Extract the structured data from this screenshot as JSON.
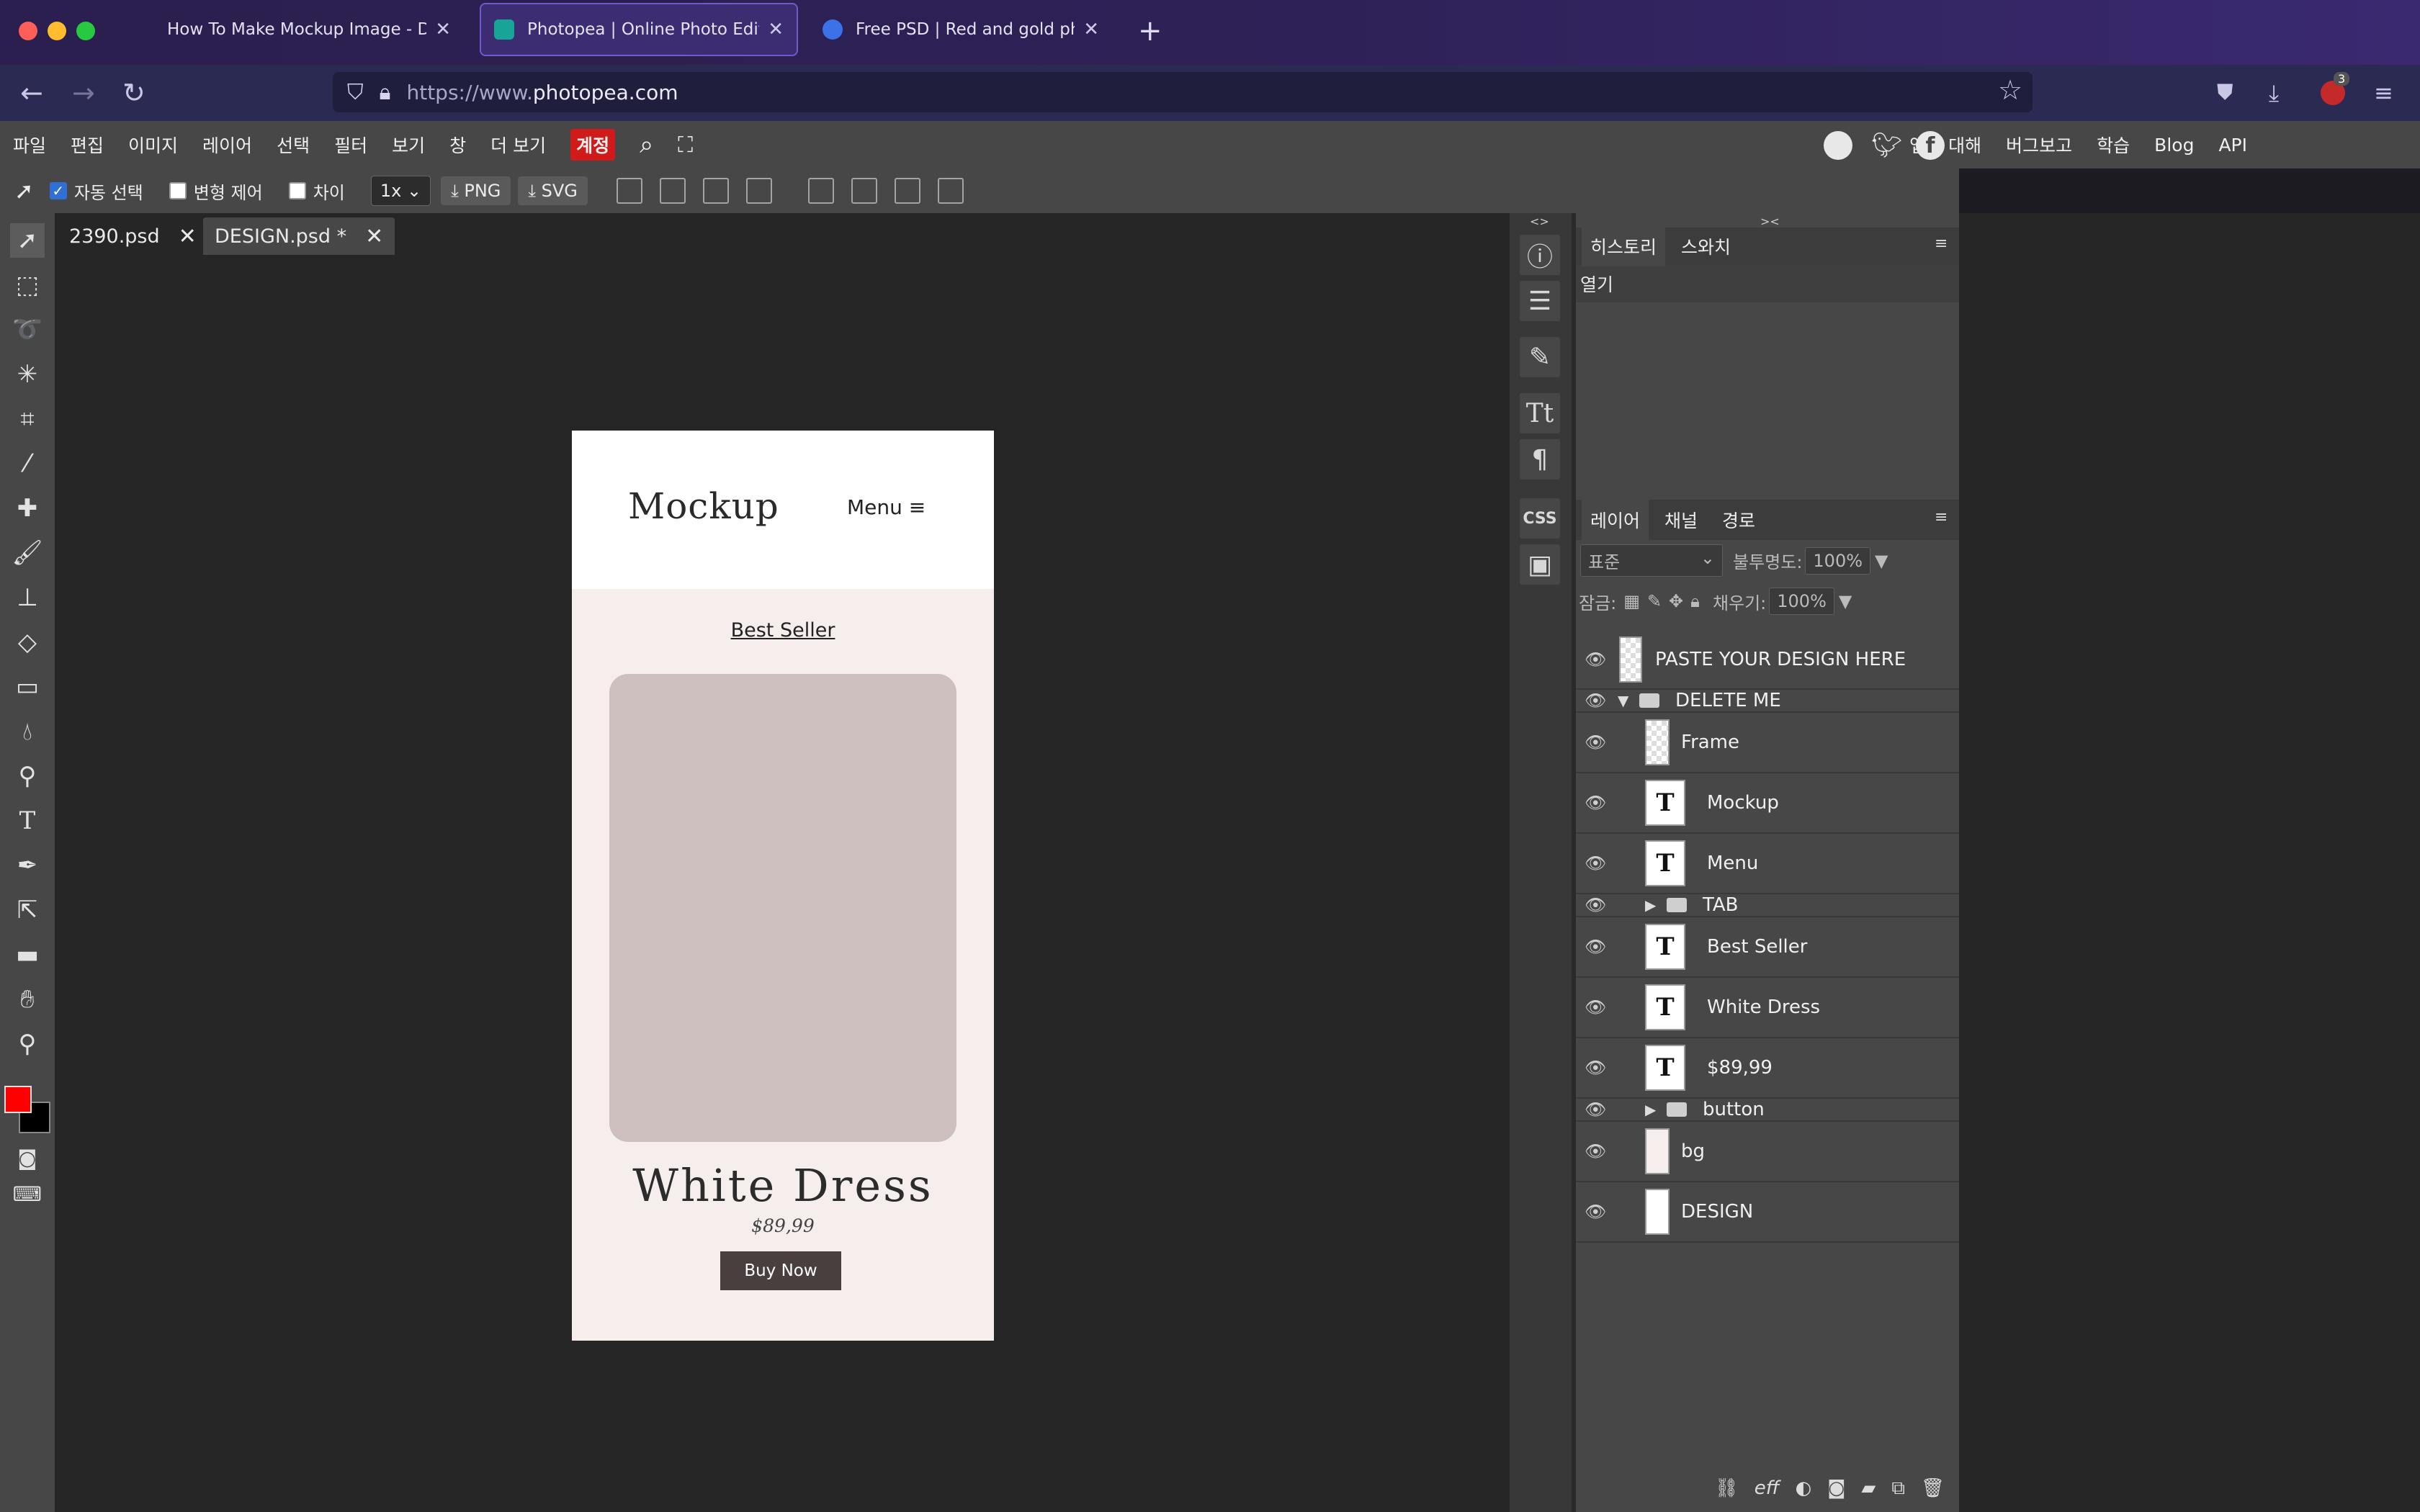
{
  "browser": {
    "tabs": [
      {
        "title": "How To Make Mockup Image - Devle",
        "active": false
      },
      {
        "title": "Photopea | Online Photo Editor",
        "active": true
      },
      {
        "title": "Free PSD | Red and gold phone",
        "active": false
      }
    ],
    "new_tab": "+",
    "url_prefix": "https://www.",
    "url_domain": "photopea.com",
    "notification_badge": "3"
  },
  "menu": {
    "items": [
      "파일",
      "편집",
      "이미지",
      "레이어",
      "선택",
      "필터",
      "보기",
      "창",
      "더 보기",
      "계정"
    ],
    "right": [
      "앱에 대해",
      "버그보고",
      "학습",
      "Blog",
      "API"
    ]
  },
  "toolopts": {
    "auto_select": "자동 선택",
    "transform": "변형 제어",
    "diff": "차이",
    "zoom": "1x",
    "png": "PNG",
    "svg": "SVG"
  },
  "doc_tabs": [
    {
      "name": "2390.psd",
      "active": false
    },
    {
      "name": "DESIGN.psd *",
      "active": true
    }
  ],
  "document": {
    "logo": "Mockup",
    "menu": "Menu ≡",
    "tab": "Best Seller",
    "product_title": "White Dress",
    "price": "$89,99",
    "button": "Buy Now"
  },
  "history_panel": {
    "tabs": [
      "히스토리",
      "스와치"
    ],
    "entries": [
      "열기"
    ]
  },
  "layers_panel": {
    "tabs": [
      "레이어",
      "채널",
      "경로"
    ],
    "blend_mode": "표준",
    "opacity_label": "불투명도:",
    "opacity_value": "100%",
    "lock_label": "잠금:",
    "fill_label": "채우기:",
    "fill_value": "100%",
    "layers": [
      "PASTE YOUR DESIGN HERE",
      "DELETE ME",
      "Frame",
      "Mockup",
      "Menu",
      "TAB",
      "Best Seller",
      "White Dress",
      "$89,99",
      "button",
      "bg",
      "DESIGN"
    ],
    "footer_icons": [
      "link-icon",
      "effects-icon",
      "adjustment-icon",
      "mask-icon",
      "folder-icon",
      "new-layer-icon",
      "trash-icon"
    ]
  },
  "colors": {
    "foreground": "#ff0000",
    "background": "#000000"
  }
}
